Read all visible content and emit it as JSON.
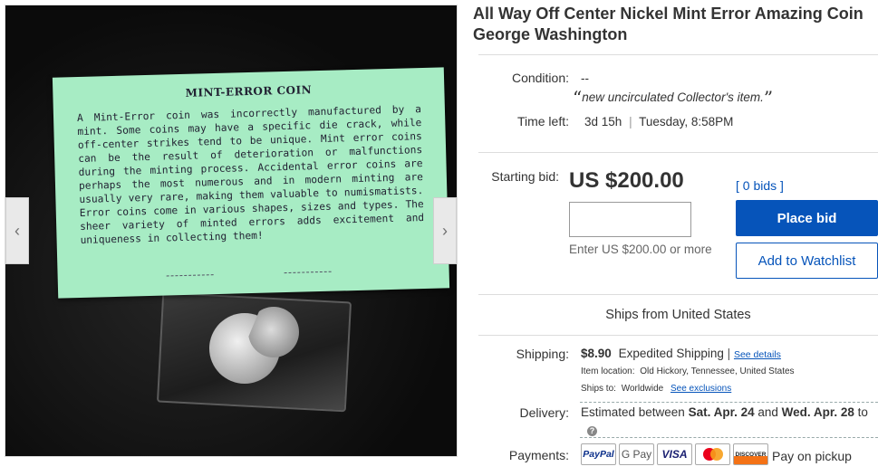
{
  "gallery": {
    "card_title": "MINT-ERROR COIN",
    "card_text": "A Mint-Error coin was incorrectly manufactured by a mint. Some coins may have a specific die crack, while off-center strikes tend to be unique. Mint error coins can be the result of deterioration or malfunctions during the minting process. Accidental error coins are perhaps the most numerous and in modern minting are usually very rare, making them valuable to numismatists. Error coins come in various shapes, sizes and types. The sheer variety of minted errors adds excitement and uniqueness in collecting them!",
    "prev_icon": "‹",
    "next_icon": "›"
  },
  "listing": {
    "title": "All Way Off Center Nickel Mint Error Amazing Coin George Washington",
    "condition_label": "Condition:",
    "condition_value": "--",
    "condition_note": "new uncirculated Collector's item.",
    "quote_open": "“",
    "quote_close": "”",
    "time_left_label": "Time left:",
    "time_left_value": "3d 15h",
    "time_left_end": "Tuesday, 8:58PM",
    "starting_bid_label": "Starting bid:",
    "starting_bid_price": "US $200.00",
    "bids_count": "[ 0 bids ]",
    "bid_hint": "Enter US $200.00 or more",
    "place_bid_label": "Place bid",
    "watchlist_label": "Add to Watchlist",
    "ships_from": "Ships from United States"
  },
  "shipping": {
    "label": "Shipping:",
    "cost": "$8.90",
    "method": "Expedited Shipping",
    "see_details": "See details",
    "item_location_label": "Item location:",
    "item_location": "Old Hickory, Tennessee, United States",
    "ships_to_label": "Ships to:",
    "ships_to": "Worldwide",
    "see_exclusions": "See exclusions"
  },
  "delivery": {
    "label": "Delivery:",
    "text_pre": "Estimated between ",
    "date_start": "Sat. Apr. 24",
    "text_mid": " and ",
    "date_end": "Wed. Apr. 28",
    "text_post": " to",
    "help_icon": "?"
  },
  "payments": {
    "label": "Payments:",
    "methods": [
      "PayPal",
      "G Pay",
      "VISA",
      "",
      "DISCOVER"
    ],
    "pickup": "Pay on pickup"
  },
  "colors": {
    "accent": "#0654ba",
    "card": "#a7ecc4"
  }
}
